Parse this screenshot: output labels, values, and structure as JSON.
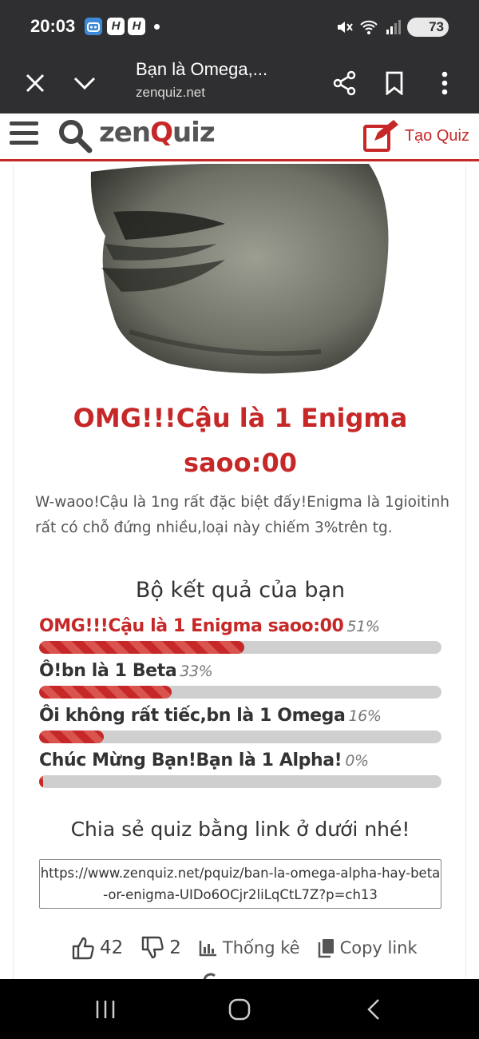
{
  "status_bar": {
    "time": "20:03",
    "battery": "73"
  },
  "browser": {
    "page_title": "Bạn là Omega,...",
    "domain": "zenquiz.net"
  },
  "site": {
    "logo_prefix": "zen",
    "logo_q": "Q",
    "logo_suffix": "uiz",
    "create_label": "Tạo Quiz",
    "brand_color": "#c62828"
  },
  "result": {
    "title": "OMG!!!Cậu là 1 Enigma saoo:00",
    "description": "W-waoo!Cậu là 1ng rất đặc biệt đấy!Enigma là 1gioitinh rất có chỗ đứng nhiều,loại này chiếm 3%trên tg."
  },
  "results_set": {
    "heading": "Bộ kết quả của bạn",
    "items": [
      {
        "label": "OMG!!!Cậu là 1 Enigma saoo:00",
        "percent_text": "51%",
        "percent": 51
      },
      {
        "label": "Ô!bn là 1 Beta",
        "percent_text": "33%",
        "percent": 33
      },
      {
        "label": "Ôi không rất tiếc,bn là 1 Omega",
        "percent_text": "16%",
        "percent": 16
      },
      {
        "label": "Chúc Mừng Bạn!Bạn là 1 Alpha!",
        "percent_text": "0%",
        "percent": 0
      }
    ]
  },
  "share": {
    "heading": "Chia sẻ quiz bằng link ở dưới nhé!",
    "link": "https://www.zenquiz.net/pquiz/ban-la-omega-alpha-hay-beta-or-enigma-UIDo6OCjr2liLqCtL7Z?p=ch13"
  },
  "actions": {
    "likes": "42",
    "dislikes": "2",
    "stats_label": "Thống kê",
    "copy_label": "Copy link"
  },
  "icons": {
    "close": "close-icon",
    "collapse": "chevron-down-icon",
    "share": "share-icon",
    "bookmark": "bookmark-icon",
    "more": "more-vert-icon",
    "menu": "hamburger-icon",
    "search": "search-icon",
    "create": "edit-icon",
    "like": "thumbs-up-icon",
    "dislike": "thumbs-down-icon",
    "stats": "bar-chart-icon",
    "copy": "copy-icon"
  }
}
